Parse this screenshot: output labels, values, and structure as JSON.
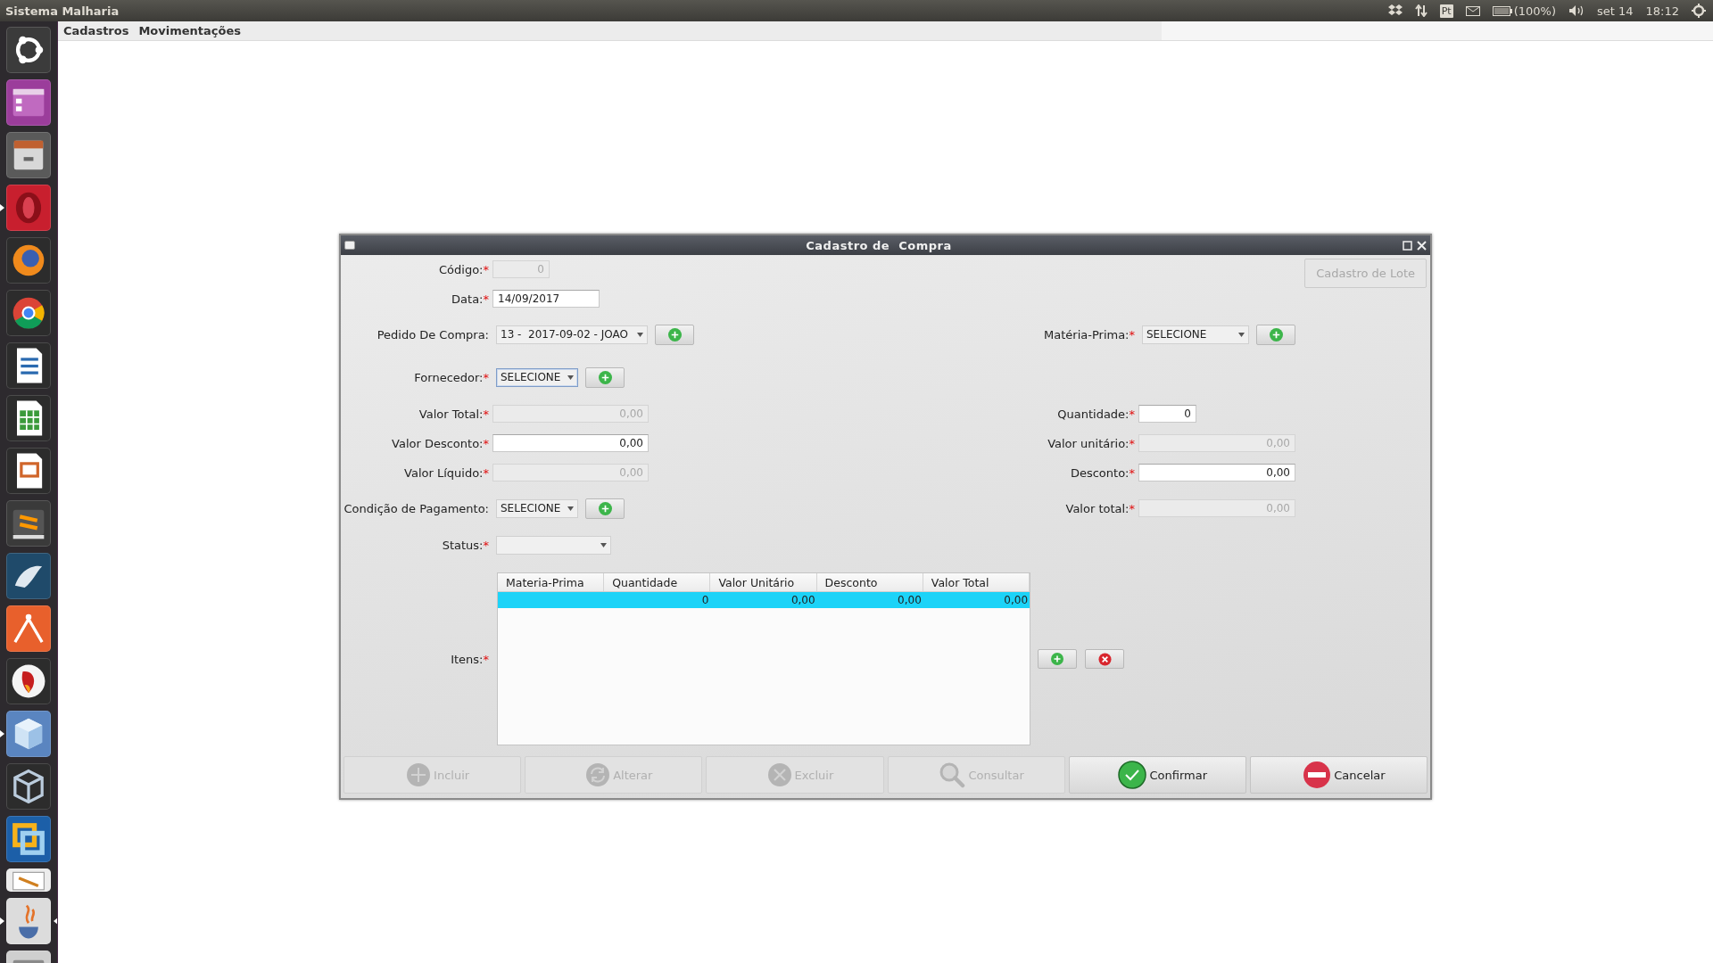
{
  "top_bar": {
    "title": "Sistema Malharia",
    "keyboard": "Pt",
    "battery": "(100%)",
    "date": "set 14",
    "time": "18:12"
  },
  "launcher": [
    {
      "kind": "ubuntu",
      "running": false,
      "focused": false
    },
    {
      "kind": "workspaces",
      "running": false,
      "focused": false
    },
    {
      "kind": "files",
      "running": false,
      "focused": false
    },
    {
      "kind": "opera",
      "running": true,
      "focused": false
    },
    {
      "kind": "firefox",
      "running": false,
      "focused": false
    },
    {
      "kind": "chrome",
      "running": false,
      "focused": false
    },
    {
      "kind": "writer",
      "running": false,
      "focused": false
    },
    {
      "kind": "calc",
      "running": false,
      "focused": false
    },
    {
      "kind": "impress",
      "running": false,
      "focused": false
    },
    {
      "kind": "sublime",
      "running": false,
      "focused": false
    },
    {
      "kind": "mysql",
      "running": false,
      "focused": false
    },
    {
      "kind": "antenna",
      "running": false,
      "focused": false
    },
    {
      "kind": "bird",
      "running": false,
      "focused": false
    },
    {
      "kind": "cube",
      "running": true,
      "focused": false
    },
    {
      "kind": "virtualbox",
      "running": false,
      "focused": false
    },
    {
      "kind": "vmware",
      "running": false,
      "focused": false
    },
    {
      "kind": "notepad",
      "running": false,
      "focused": false
    },
    {
      "kind": "java",
      "running": true,
      "focused": true
    },
    {
      "kind": "disk",
      "running": false,
      "focused": false
    }
  ],
  "menu": [
    {
      "label": "Cadastros"
    },
    {
      "label": "Movimentações"
    }
  ],
  "dialog": {
    "title": "Cadastro de  Compra",
    "rows": [
      {
        "left": {
          "kind": "number",
          "label": "Código:",
          "required_mark": "*",
          "value": "0",
          "disabled": true
        },
        "right": {
          "kind": "button",
          "label": "Cadastro de Lote",
          "disabled": true
        }
      },
      {
        "left": {
          "kind": "text",
          "label": "Data:",
          "required_mark": "*",
          "value": "14/09/2017",
          "disabled": false
        }
      },
      {
        "left": {
          "kind": "select",
          "label": "Pedido De Compra:",
          "value": "13 -  2017-09-02 - JOAO",
          "focused": false,
          "add": true
        },
        "right": {
          "kind": "select",
          "label": "Matéria-Prima:",
          "required_mark": "*",
          "value": "SELECIONE",
          "focused": false,
          "add": true
        }
      },
      {
        "left": {
          "kind": "select",
          "label": "Fornecedor:",
          "required_mark": "*",
          "value": "SELECIONE",
          "focused": true,
          "add": true
        }
      },
      {
        "left": {
          "kind": "number",
          "label": "Valor Total:",
          "required_mark": "*",
          "value": "0,00",
          "disabled": true
        },
        "right": {
          "kind": "number",
          "label": "Quantidade:",
          "required_mark": "*",
          "value": "0",
          "disabled": false
        }
      },
      {
        "left": {
          "kind": "number",
          "label": "Valor Desconto:",
          "required_mark": "*",
          "value": "0,00",
          "disabled": false
        },
        "right": {
          "kind": "number",
          "label": "Valor unitário:",
          "required_mark": "*",
          "value": "0,00",
          "disabled": true
        }
      },
      {
        "left": {
          "kind": "number",
          "label": "Valor Líquido:",
          "required_mark": "*",
          "value": "0,00",
          "disabled": true
        },
        "right": {
          "kind": "number",
          "label": "Desconto:",
          "required_mark": "*",
          "value": "0,00",
          "disabled": false
        }
      },
      {
        "left": {
          "kind": "select",
          "label": "Condição de Pagamento:",
          "value": "SELECIONE",
          "focused": false,
          "add": true
        },
        "right": {
          "kind": "number",
          "label": "Valor total:",
          "required_mark": "*",
          "value": "0,00",
          "disabled": true
        }
      },
      {
        "left": {
          "kind": "select",
          "label": "Status:",
          "required_mark": "*",
          "focused": false,
          "add": false
        }
      }
    ],
    "items": {
      "label": "Itens:",
      "required_mark": "*",
      "columns": [
        "Materia-Prima",
        "Quantidade",
        "Valor Unitário",
        "Desconto",
        "Valor Total"
      ],
      "rows": [
        {
          "selected": true,
          "cells": [
            null,
            "0",
            "0,00",
            "0,00",
            "0,00"
          ]
        }
      ],
      "buttons": [
        {
          "kind": "add"
        },
        {
          "kind": "remove"
        }
      ]
    },
    "actions": [
      {
        "kind": "add",
        "label": "Incluir",
        "disabled": true
      },
      {
        "kind": "edit",
        "label": "Alterar",
        "disabled": true
      },
      {
        "kind": "delete",
        "label": "Excluir",
        "disabled": true
      },
      {
        "kind": "search",
        "label": "Consultar",
        "disabled": true
      },
      {
        "kind": "confirm",
        "label": "Confirmar",
        "disabled": false
      },
      {
        "kind": "cancel",
        "label": "Cancelar",
        "disabled": false
      }
    ]
  }
}
